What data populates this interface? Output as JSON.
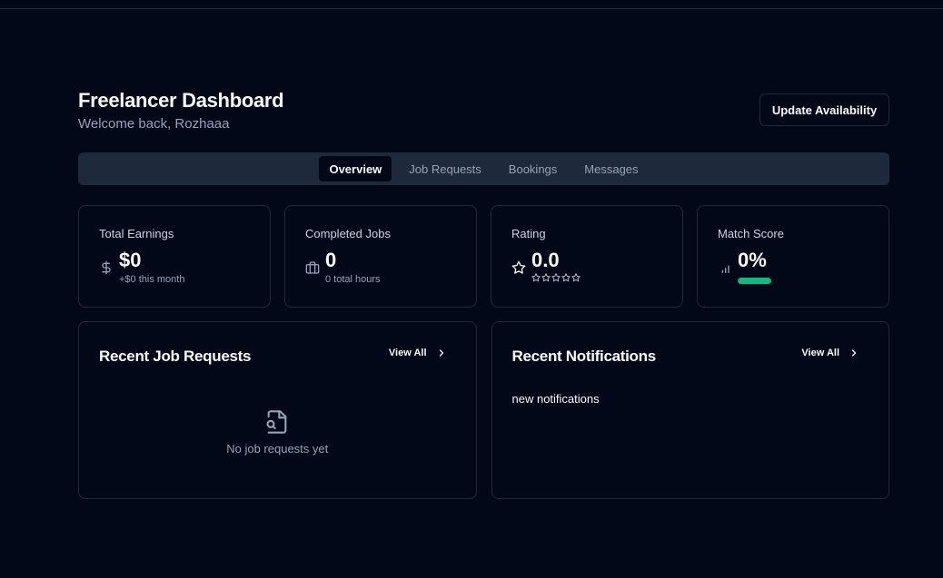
{
  "header": {
    "title": "Freelancer Dashboard",
    "subtitle": "Welcome back, Rozhaaa",
    "update_button": "Update Availability"
  },
  "tabs": [
    {
      "label": "Overview",
      "active": true
    },
    {
      "label": "Job Requests",
      "active": false
    },
    {
      "label": "Bookings",
      "active": false
    },
    {
      "label": "Messages",
      "active": false
    }
  ],
  "stats": {
    "earnings": {
      "label": "Total Earnings",
      "icon": "dollar-icon",
      "value": "$0",
      "sub": "+$0 this month"
    },
    "jobs": {
      "label": "Completed Jobs",
      "icon": "briefcase-icon",
      "value": "0",
      "sub": "0 total hours"
    },
    "rating": {
      "label": "Rating",
      "icon": "star-icon",
      "value": "0.0",
      "stars_filled": 0,
      "stars_total": 5
    },
    "match": {
      "label": "Match Score",
      "icon": "signal-icon",
      "value": "0%",
      "progress": 0
    }
  },
  "panels": {
    "jobs": {
      "title": "Recent Job Requests",
      "view_all": "View All",
      "empty_text": "No job requests yet",
      "empty_icon": "file-search-icon"
    },
    "notifications": {
      "title": "Recent Notifications",
      "view_all": "View All",
      "text": "new notifications"
    }
  },
  "colors": {
    "background": "#020817",
    "border": "#1e293b",
    "muted": "#94a3b8",
    "accent_green": "#10b981"
  }
}
